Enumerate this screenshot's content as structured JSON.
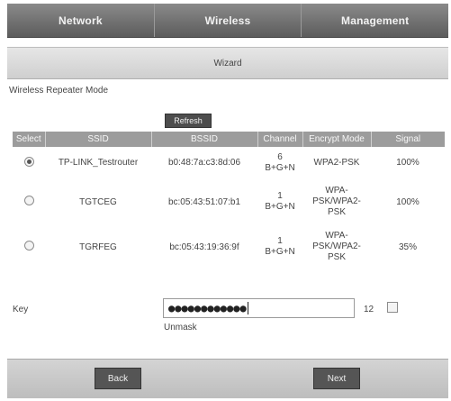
{
  "nav": {
    "tabs": [
      {
        "label": "Network"
      },
      {
        "label": "Wireless"
      },
      {
        "label": "Management"
      }
    ],
    "subtab": "Wizard"
  },
  "mode_title": "Wireless Repeater Mode",
  "refresh_label": "Refresh",
  "table": {
    "headers": [
      "Select",
      "SSID",
      "BSSID",
      "Channel",
      "Encrypt Mode",
      "Signal"
    ],
    "rows": [
      {
        "selected": true,
        "ssid": "TP-LINK_Testrouter",
        "bssid": "b0:48:7a:c3:8d:06",
        "channel_num": "6",
        "channel_mode": "B+G+N",
        "encrypt_lines": [
          "WPA2-PSK"
        ],
        "signal": "100%"
      },
      {
        "selected": false,
        "ssid": "TGTCEG",
        "bssid": "bc:05:43:51:07:b1",
        "channel_num": "1",
        "channel_mode": "B+G+N",
        "encrypt_lines": [
          "WPA-",
          "PSK/WPA2-",
          "PSK"
        ],
        "signal": "100%"
      },
      {
        "selected": false,
        "ssid": "TGRFEG",
        "bssid": "bc:05:43:19:36:9f",
        "channel_num": "1",
        "channel_mode": "B+G+N",
        "encrypt_lines": [
          "WPA-",
          "PSK/WPA2-",
          "PSK"
        ],
        "signal": "35%"
      }
    ]
  },
  "key": {
    "label": "Key",
    "masked_value": "●●●●●●●●●●●●",
    "length": "12",
    "unmask_label": "Unmask",
    "unmask_checked": false
  },
  "footer": {
    "back_label": "Back",
    "next_label": "Next"
  }
}
